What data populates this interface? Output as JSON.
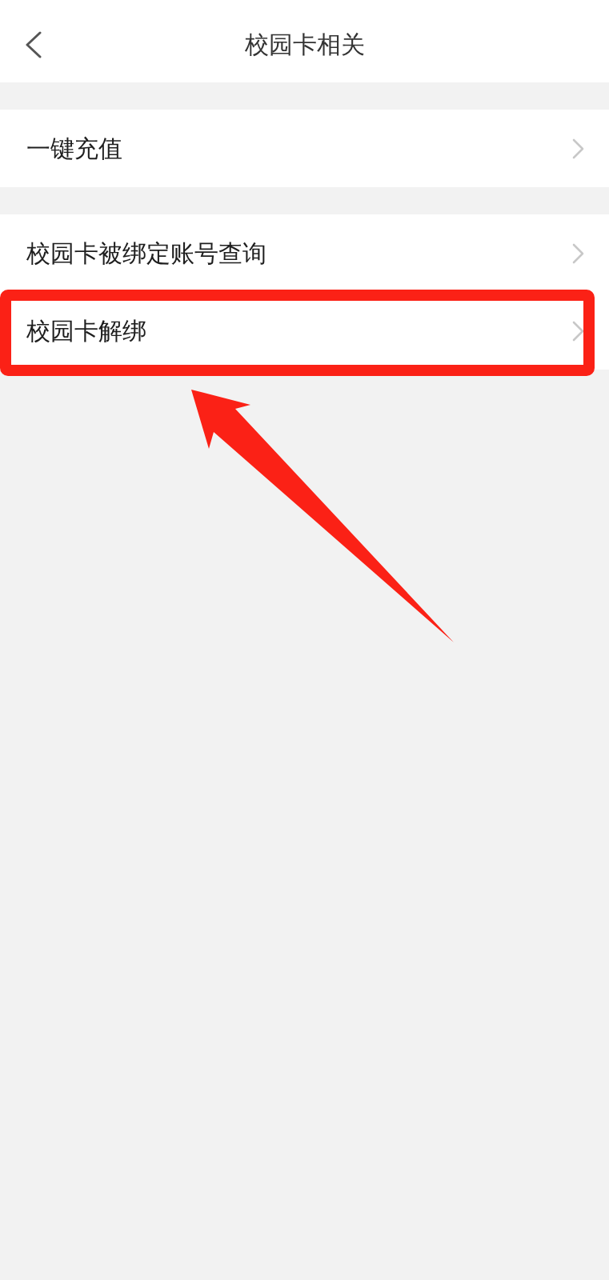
{
  "header": {
    "title": "校园卡相关"
  },
  "groups": [
    {
      "items": [
        {
          "label": "一键充值",
          "highlighted": false
        }
      ]
    },
    {
      "items": [
        {
          "label": "校园卡被绑定账号查询",
          "highlighted": false
        },
        {
          "label": "校园卡解绑",
          "highlighted": true
        }
      ]
    }
  ]
}
